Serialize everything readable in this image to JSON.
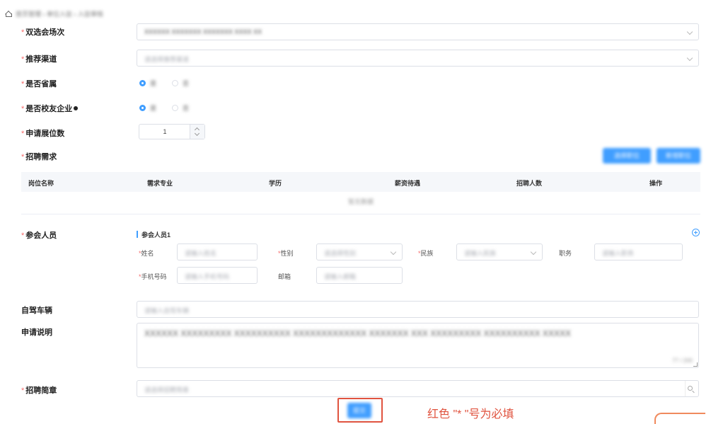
{
  "breadcrumb": "首页管理 › 单位入驻 › 入驻审核",
  "form": {
    "session_label": "双选会场次",
    "session_value": "XXXXXX XXXXXXX XXXXXXX XXXX XX",
    "channel_label": "推荐渠道",
    "channel_placeholder": "请选择推荐渠道",
    "local_label": "是否省属",
    "local_yes": "是",
    "local_no": "否",
    "alumni_label": "是否校友企业",
    "alumni_yes": "是",
    "alumni_no": "否",
    "booth_label": "申请展位数",
    "booth_value": "1",
    "recruit_label": "招聘需求",
    "btn_select_position": "选择职位",
    "btn_new_position": "新增职位"
  },
  "table": {
    "columns": [
      "岗位名称",
      "需求专业",
      "学历",
      "薪资待遇",
      "招聘人数",
      "操作"
    ],
    "empty_text": "暂无数据"
  },
  "attendees": {
    "label": "参会人员",
    "group_title": "参会人员1",
    "name_label": "姓名",
    "name_placeholder": "请输入姓名",
    "gender_label": "性别",
    "gender_placeholder": "请选择性别",
    "ethnicity_label": "民族",
    "ethnicity_placeholder": "请输入民族",
    "position_label": "职务",
    "position_placeholder": "请输入职务",
    "phone_label": "手机号码",
    "phone_placeholder": "请输入手机号码",
    "email_label": "邮箱",
    "email_placeholder": "请输入邮箱"
  },
  "car": {
    "label": "自驾车辆",
    "placeholder": "请输入自驾车辆"
  },
  "desc": {
    "label": "申请说明",
    "value": "XXXXXX XXXXXXXXX XXXXXXXXXX XXXXXXXXXXXXX XXXXXXX XXX XXXXXXXXX XXXXXXXXXX XXXXX",
    "counter": "77 / 200"
  },
  "brochure": {
    "label": "招聘简章",
    "placeholder": "请选择招聘简章"
  },
  "submit_label": "提交",
  "annotation": "红色 \"* \"号为必填",
  "colors": {
    "primary": "#409eff",
    "required": "#f56c6c",
    "annotation": "#e0533f"
  }
}
